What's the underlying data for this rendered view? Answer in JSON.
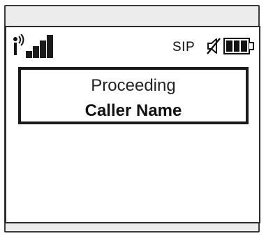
{
  "status_bar": {
    "protocol": "SIP",
    "signal_level": 4,
    "signal_max": 4,
    "battery_level": 1.0,
    "icons": [
      "antenna-icon",
      "signal-bars-icon",
      "speaker-muted-icon",
      "battery-icon"
    ]
  },
  "call": {
    "status": "Proceeding",
    "caller_name": "Caller Name"
  },
  "colors": {
    "lcd_background": "#ffffff",
    "frame": "#ececec",
    "ink": "#111111"
  }
}
